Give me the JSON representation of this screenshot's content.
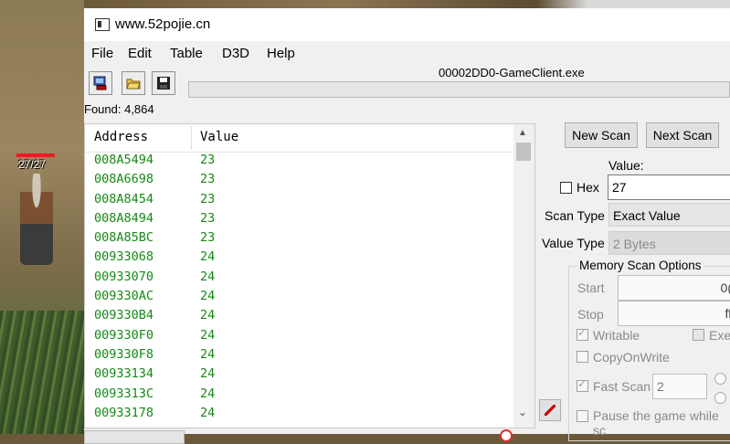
{
  "window": {
    "title": "www.52pojie.cn"
  },
  "game": {
    "hp_text": "27/27"
  },
  "menu": [
    "File",
    "Edit",
    "Table",
    "D3D",
    "Help"
  ],
  "toolbar": {
    "process_title": "00002DD0-GameClient.exe"
  },
  "results": {
    "found_label": "Found: 4,864",
    "columns": [
      "Address",
      "Value"
    ],
    "rows": [
      {
        "address": "008A5494",
        "value": "23"
      },
      {
        "address": "008A6698",
        "value": "23"
      },
      {
        "address": "008A8454",
        "value": "23"
      },
      {
        "address": "008A8494",
        "value": "23"
      },
      {
        "address": "008A85BC",
        "value": "23"
      },
      {
        "address": "00933068",
        "value": "24"
      },
      {
        "address": "00933070",
        "value": "24"
      },
      {
        "address": "009330AC",
        "value": "24"
      },
      {
        "address": "009330B4",
        "value": "24"
      },
      {
        "address": "009330F0",
        "value": "24"
      },
      {
        "address": "009330F8",
        "value": "24"
      },
      {
        "address": "00933134",
        "value": "24"
      },
      {
        "address": "0093313C",
        "value": "24"
      },
      {
        "address": "00933178",
        "value": "24"
      }
    ]
  },
  "scan": {
    "new_scan": "New Scan",
    "next_scan": "Next Scan",
    "value_label": "Value:",
    "hex_label": "Hex",
    "value": "27",
    "scan_type_label": "Scan Type",
    "scan_type": "Exact Value",
    "value_type_label": "Value Type",
    "value_type": "2 Bytes"
  },
  "memory_options": {
    "title": "Memory Scan Options",
    "start_label": "Start",
    "start_value": "0(",
    "stop_label": "Stop",
    "stop_value": "ff",
    "writable": "Writable",
    "executable": "Exe",
    "copy_on_write": "CopyOnWrite",
    "fast_scan": "Fast Scan",
    "fast_scan_value": "2",
    "pause": "Pause the game while sc"
  }
}
